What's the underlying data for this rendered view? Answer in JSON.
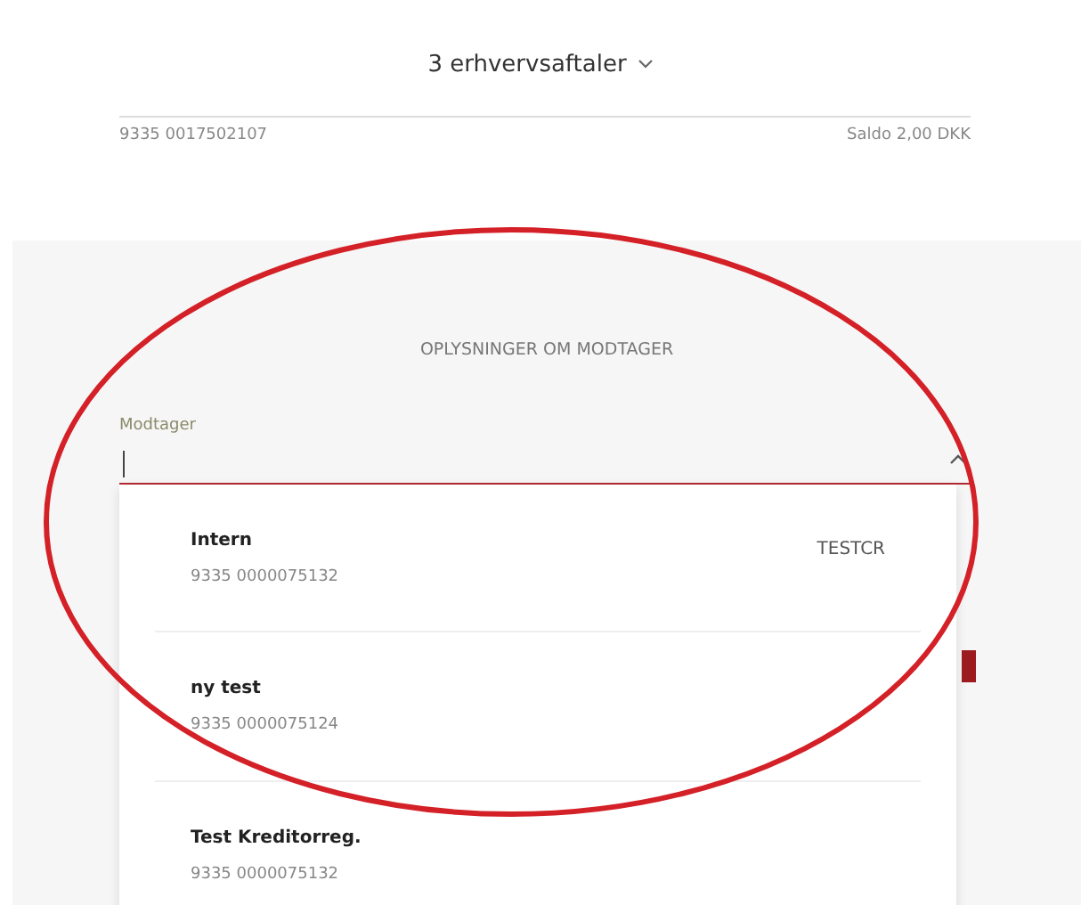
{
  "header": {
    "title": "3 erhvervsaftaler"
  },
  "account": {
    "number": "9335 0017502107",
    "balance": "Saldo 2,00 DKK"
  },
  "recipient_section": {
    "heading": "OPLYSNINGER OM MODTAGER",
    "field": {
      "label": "Modtager",
      "expanded": true
    },
    "options": [
      {
        "name": "Intern",
        "number": "9335 0000075132",
        "tag": "TESTCR"
      },
      {
        "name": "ny test",
        "number": "9335 0000075124"
      },
      {
        "name": "Test Kreditorreg.",
        "number": "9335 0000075132"
      }
    ]
  }
}
